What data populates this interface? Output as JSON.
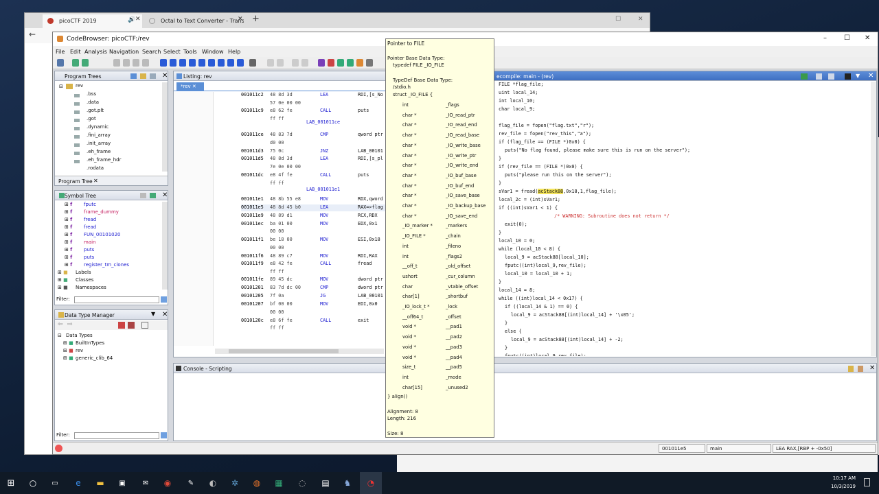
{
  "browser": {
    "tabs": [
      {
        "label": "picoCTF 2019"
      },
      {
        "label": "Octal to Text Converter - Trans"
      }
    ],
    "new_tab": "+",
    "back": "←"
  },
  "ghidra": {
    "title": "CodeBrowser: picoCTF:/rev",
    "menu": [
      "File",
      "Edit",
      "Analysis",
      "Navigation",
      "Search",
      "Select",
      "Tools",
      "Window",
      "Help"
    ],
    "win_controls": [
      "–",
      "☐",
      "✕"
    ]
  },
  "program_trees": {
    "title": "Program Trees",
    "root": "rev",
    "items": [
      ".bss",
      ".data",
      ".got.plt",
      ".got",
      ".dynamic",
      ".fini_array",
      ".init_array",
      ".eh_frame",
      ".eh_frame_hdr",
      ".rodata"
    ],
    "tab": "Program Tree"
  },
  "symbol_tree": {
    "title": "Symbol Tree",
    "items": [
      "fputc",
      "frame_dummy",
      "fread",
      "fread",
      "FUN_00101020",
      "main",
      "puts",
      "puts",
      "register_tm_clones"
    ],
    "folders": [
      "Labels",
      "Classes",
      "Namespaces"
    ],
    "filter_label": "Filter:"
  },
  "data_type_manager": {
    "title": "Data Type Manager",
    "items": [
      "Data Types",
      "BuiltInTypes",
      "rev",
      "generic_clib_64"
    ],
    "filter_label": "Filter:"
  },
  "listing": {
    "title": "Listing:  rev",
    "tab": "*rev",
    "rows": [
      {
        "ad": "001011c2",
        "by": "48 8d 3d",
        "mn": "LEA",
        "op": "RDI,[s_No"
      },
      {
        "ad": "",
        "by": "57 0e 00 00",
        "mn": "",
        "op": ""
      },
      {
        "ad": "001011c9",
        "by": "e8 62 fe",
        "mn": "CALL",
        "op": "puts"
      },
      {
        "ad": "",
        "by": "ff ff",
        "mn": "",
        "op": ""
      },
      {
        "ad": "001011ce",
        "by": "48 83 7d",
        "mn": "CMP",
        "op": "qword ptr"
      },
      {
        "ad": "",
        "by": "d0 00",
        "mn": "",
        "op": ""
      },
      {
        "ad": "001011d3",
        "by": "75 0c",
        "mn": "JNZ",
        "op": "LAB_00101"
      },
      {
        "ad": "001011d5",
        "by": "48 8d 3d",
        "mn": "LEA",
        "op": "RDI,[s_pl"
      },
      {
        "ad": "",
        "by": "7e 0e 00 00",
        "mn": "",
        "op": ""
      },
      {
        "ad": "001011dc",
        "by": "e8 4f fe",
        "mn": "CALL",
        "op": "puts"
      },
      {
        "ad": "",
        "by": "ff ff",
        "mn": "",
        "op": ""
      },
      {
        "ad": "001011e1",
        "by": "48 8b 55 e8",
        "mn": "MOV",
        "op": "RDX,qword"
      },
      {
        "ad": "001011e5",
        "by": "48 8d 45 b0",
        "mn": "LEA",
        "op": "RAX=>flag"
      },
      {
        "ad": "001011e9",
        "by": "48 89 d1",
        "mn": "MOV",
        "op": "RCX,RDX"
      },
      {
        "ad": "001011ec",
        "by": "ba 01 00",
        "mn": "MOV",
        "op": "EDX,0x1"
      },
      {
        "ad": "",
        "by": "00 00",
        "mn": "",
        "op": ""
      },
      {
        "ad": "001011f1",
        "by": "be 18 00",
        "mn": "MOV",
        "op": "ESI,0x18"
      },
      {
        "ad": "",
        "by": "00 00",
        "mn": "",
        "op": ""
      },
      {
        "ad": "001011f6",
        "by": "48 89 c7",
        "mn": "MOV",
        "op": "RDI,RAX"
      },
      {
        "ad": "001011f9",
        "by": "e8 42 fe",
        "mn": "CALL",
        "op": "fread"
      },
      {
        "ad": "",
        "by": "ff ff",
        "mn": "",
        "op": ""
      },
      {
        "ad": "001011fe",
        "by": "89 45 dc",
        "mn": "MOV",
        "op": "dword ptr"
      },
      {
        "ad": "00101201",
        "by": "83 7d dc 00",
        "mn": "CMP",
        "op": "dword ptr"
      },
      {
        "ad": "00101205",
        "by": "7f 0a",
        "mn": "JG",
        "op": "LAB_00101"
      },
      {
        "ad": "00101207",
        "by": "bf 00 00",
        "mn": "MOV",
        "op": "EDI,0x0"
      },
      {
        "ad": "",
        "by": "00 00",
        "mn": "",
        "op": ""
      },
      {
        "ad": "0010120c",
        "by": "e8 6f fe",
        "mn": "CALL",
        "op": "exit"
      },
      {
        "ad": "",
        "by": "ff ff",
        "mn": "",
        "op": ""
      }
    ],
    "labels": [
      "LAB_001011ce",
      "LAB_001011e1"
    ]
  },
  "tooltip": {
    "title": "Pointer to FILE",
    "base_label": "Pointer Base Data Type:",
    "base_value": "typedef FILE _IO_FILE",
    "typedef_label": "TypeDef Base Data Type:",
    "typedef_value": "/stdio.h",
    "struct_open": "struct _IO_FILE {",
    "fields": [
      {
        "t": "int",
        "n": "_flags"
      },
      {
        "t": "char *",
        "n": "_IO_read_ptr"
      },
      {
        "t": "char *",
        "n": "_IO_read_end"
      },
      {
        "t": "char *",
        "n": "_IO_read_base"
      },
      {
        "t": "char *",
        "n": "_IO_write_base"
      },
      {
        "t": "char *",
        "n": "_IO_write_ptr"
      },
      {
        "t": "char *",
        "n": "_IO_write_end"
      },
      {
        "t": "char *",
        "n": "_IO_buf_base"
      },
      {
        "t": "char *",
        "n": "_IO_buf_end"
      },
      {
        "t": "char *",
        "n": "_IO_save_base"
      },
      {
        "t": "char *",
        "n": "_IO_backup_base"
      },
      {
        "t": "char *",
        "n": "_IO_save_end"
      },
      {
        "t": "_IO_marker *",
        "n": "_markers"
      },
      {
        "t": "_IO_FILE *",
        "n": "_chain"
      },
      {
        "t": "int",
        "n": "_fileno"
      },
      {
        "t": "int",
        "n": "_flags2"
      },
      {
        "t": "__off_t",
        "n": "_old_offset"
      },
      {
        "t": "ushort",
        "n": "_cur_column"
      },
      {
        "t": "char",
        "n": "_vtable_offset"
      },
      {
        "t": "char[1]",
        "n": "_shortbuf"
      },
      {
        "t": "_IO_lock_t *",
        "n": "_lock"
      },
      {
        "t": "__off64_t",
        "n": "_offset"
      },
      {
        "t": "void *",
        "n": "__pad1"
      },
      {
        "t": "void *",
        "n": "__pad2"
      },
      {
        "t": "void *",
        "n": "__pad3"
      },
      {
        "t": "void *",
        "n": "__pad4"
      },
      {
        "t": "size_t",
        "n": "__pad5"
      },
      {
        "t": "int",
        "n": "_mode"
      },
      {
        "t": "char[15]",
        "n": "_unused2"
      }
    ],
    "struct_close": "} align()",
    "alignment": "Alignment: 8",
    "length": "Length: 216",
    "size": "Size: 8"
  },
  "decompile": {
    "title": "ecompile: main - (rev)",
    "pre_hl": "sVar1 = fread(",
    "hl_word": "acStack88",
    "post_hl": ",0x18,1,flag_file);",
    "lines": [
      {
        "x": 0,
        "t": "FILE *flag_file;"
      },
      {
        "x": 0,
        "t": "uint local_14;"
      },
      {
        "x": 0,
        "t": "int local_10;"
      },
      {
        "x": 0,
        "t": "char local_9;"
      },
      {
        "x": 0,
        "t": ""
      },
      {
        "x": 0,
        "t": "flag_file = fopen(\"flag.txt\",\"r\");"
      },
      {
        "x": 0,
        "t": "rev_file = fopen(\"rev_this\",\"a\");"
      },
      {
        "x": 0,
        "t": "if (flag_file == (FILE *)0x0) {"
      },
      {
        "x": 1,
        "t": "puts(\"No flag found, please make sure this is run on the server\");"
      },
      {
        "x": 0,
        "t": "}"
      },
      {
        "x": 0,
        "t": "if (rev_file == (FILE *)0x0) {"
      },
      {
        "x": 1,
        "t": "puts(\"please run this on the server\");"
      },
      {
        "x": 0,
        "t": "}"
      },
      {
        "x": 0,
        "t": "__HL__"
      },
      {
        "x": 0,
        "t": "local_2c = (int)sVar1;"
      },
      {
        "x": 0,
        "t": "if ((int)sVar1 < 1) {"
      },
      {
        "x": 9,
        "t": "/* WARNING: Subroutine does not return */"
      },
      {
        "x": 1,
        "t": "exit(0);"
      },
      {
        "x": 0,
        "t": "}"
      },
      {
        "x": 0,
        "t": "local_10 = 0;"
      },
      {
        "x": 0,
        "t": "while (local_10 < 8) {"
      },
      {
        "x": 1,
        "t": "local_9 = acStack88[local_10];"
      },
      {
        "x": 1,
        "t": "fputc((int)local_9,rev_file);"
      },
      {
        "x": 1,
        "t": "local_10 = local_10 + 1;"
      },
      {
        "x": 0,
        "t": "}"
      },
      {
        "x": 0,
        "t": "local_14 = 8;"
      },
      {
        "x": 0,
        "t": "while ((int)local_14 < 0x17) {"
      },
      {
        "x": 1,
        "t": "if ((local_14 & 1) == 0) {"
      },
      {
        "x": 2,
        "t": "local_9 = acStack88[(int)local_14] + '\\x05';"
      },
      {
        "x": 1,
        "t": "}"
      },
      {
        "x": 1,
        "t": "else {"
      },
      {
        "x": 2,
        "t": "local_9 = acStack88[(int)local_14] + -2;"
      },
      {
        "x": 1,
        "t": "}"
      },
      {
        "x": 1,
        "t": "fputc((int)local_9,rev_file);"
      }
    ]
  },
  "console": {
    "title": "Console - Scripting"
  },
  "status": {
    "address": "001011e5",
    "function": "main",
    "instruction": "LEA RAX,[RBP + -0x50]"
  },
  "taskbar": {
    "time": "10:17 AM",
    "date": "10/3/2019"
  }
}
